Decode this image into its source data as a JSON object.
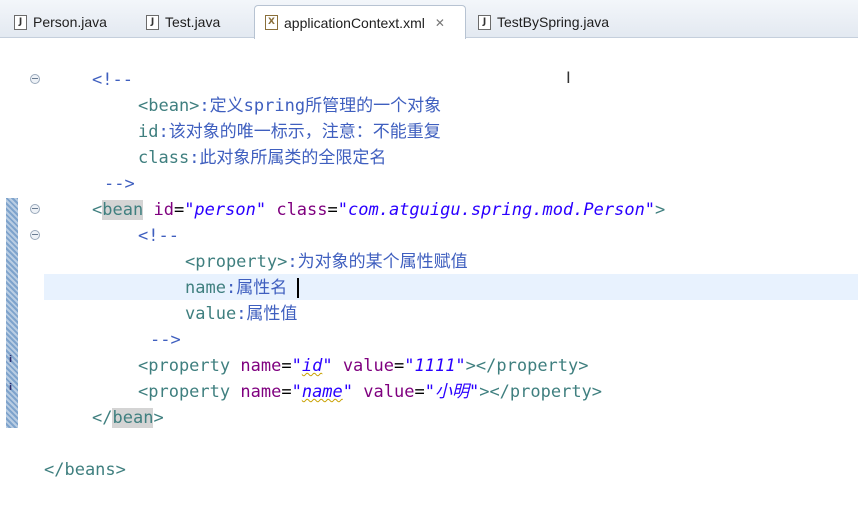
{
  "tabs": [
    {
      "label": "Person.java",
      "icon": "java-file-icon",
      "active": false
    },
    {
      "label": "Test.java",
      "icon": "java-file-icon",
      "active": false
    },
    {
      "label": "applicationContext.xml",
      "icon": "xml-file-icon",
      "active": true
    },
    {
      "label": "TestBySpring.java",
      "icon": "java-file-icon",
      "active": false
    }
  ],
  "editor": {
    "file": "applicationContext.xml",
    "lines": {
      "l1": "<!--",
      "l2a": "<bean>",
      "l2b": ":定义spring所管理的一个对象",
      "l3a": "id",
      "l3b": ":该对象的唯一标示，注意：不能重复",
      "l4a": "class",
      "l4b": ":此对象所属类的全限定名",
      "l5": "-->",
      "l6": {
        "open": "<",
        "tag": "bean",
        "attr1": "id",
        "eq1": "=",
        "val1": "\"person\"",
        "attr2": "class",
        "eq2": "=",
        "val2": "\"com.atguigu.spring.mod.Person\"",
        "close": ">"
      },
      "l7": "<!--",
      "l8a": "<property>",
      "l8b": ":为对象的某个属性赋值",
      "l9a": "name",
      "l9b": ":属性名",
      "l10a": "value",
      "l10b": ":属性值",
      "l11": "-->",
      "l12": {
        "open": "<property",
        "attr1": "name",
        "eq1": "=",
        "q1": "\"",
        "val1": "id",
        "q1e": "\"",
        "attr2": "value",
        "eq2": "=",
        "val2": "\"1111\"",
        "close": "></property>"
      },
      "l13": {
        "open": "<property",
        "attr1": "name",
        "eq1": "=",
        "q1": "\"",
        "val1": "name",
        "q1e": "\"",
        "attr2": "value",
        "eq2": "=",
        "val2": "\"小明\"",
        "close": "></property>"
      },
      "l14": {
        "open": "</",
        "tag": "bean",
        "close": ">"
      },
      "l15": "</beans>"
    }
  },
  "colors": {
    "comment": "#3f5fbf",
    "tag": "#3f7f7f",
    "attribute": "#7f007f",
    "value": "#2a00ff",
    "current_line": "#e8f2fe"
  }
}
